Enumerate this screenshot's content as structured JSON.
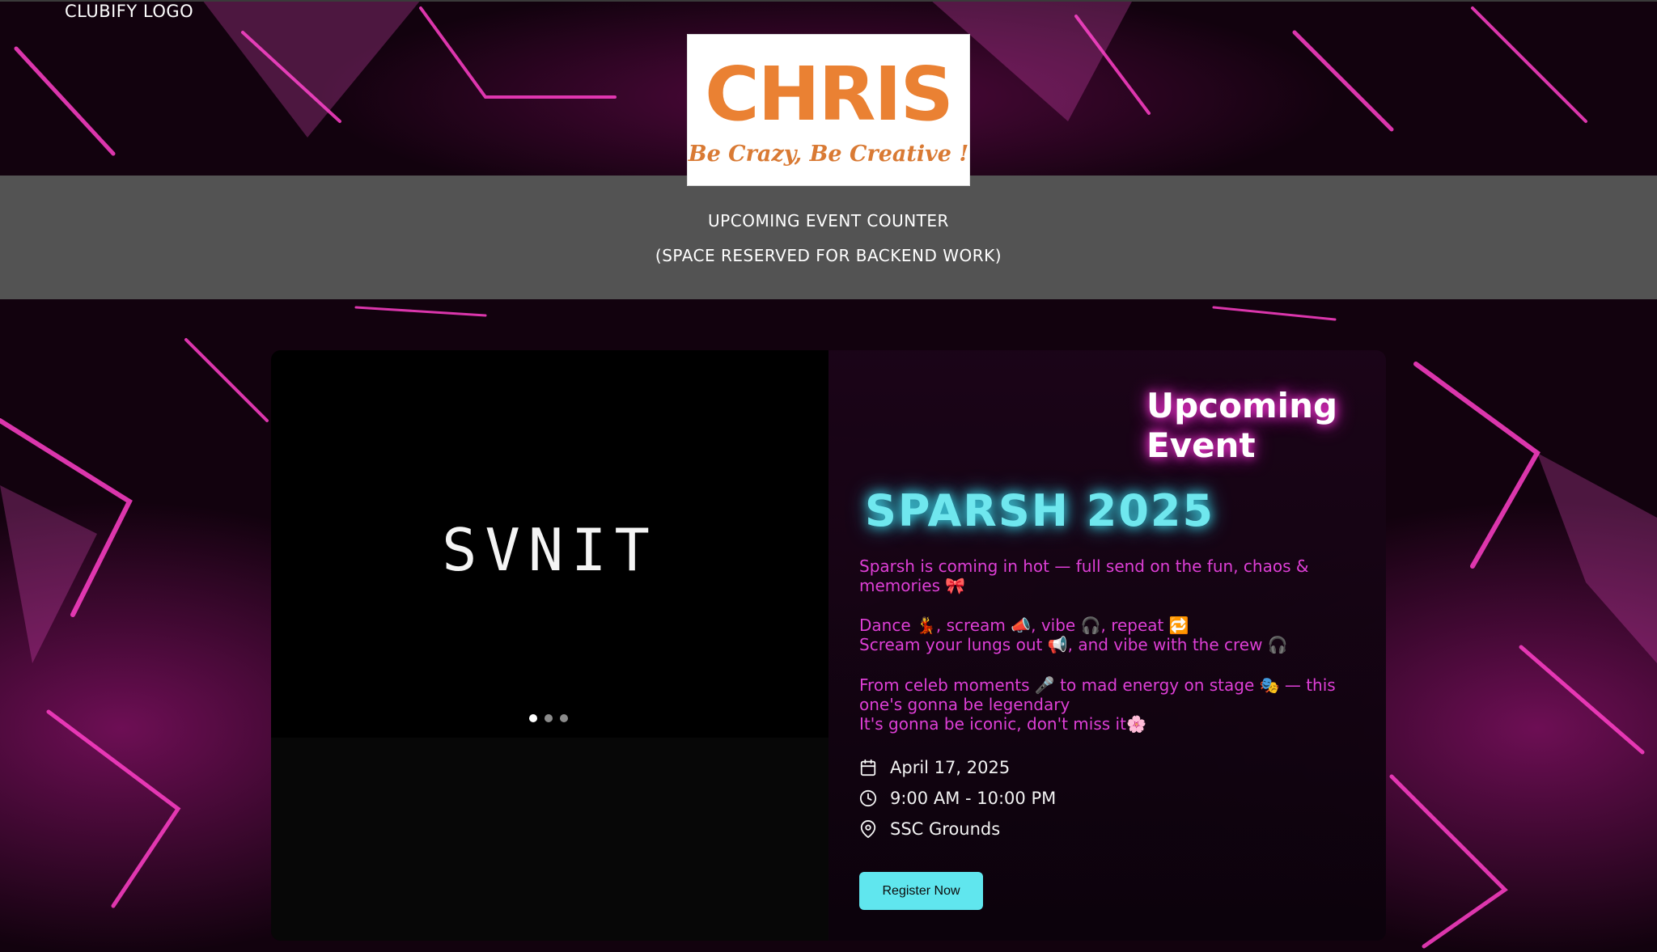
{
  "header": {
    "clubify_logo": "CLUBIFY LOGO",
    "brand_name": "CHRIS",
    "brand_tagline": "Be Crazy, Be Creative !"
  },
  "counter": {
    "title": "UPCOMING EVENT COUNTER",
    "subtitle": "(SPACE RESERVED FOR BACKEND WORK)"
  },
  "carousel": {
    "slide_text": "SVNIT",
    "dot_count": 3,
    "active_index": 0
  },
  "event": {
    "section_title": "Upcoming Event",
    "name": "SPARSH 2025",
    "desc1": "Sparsh is coming in hot — full send on the fun, chaos & memories 🎀",
    "desc2a": "Dance 💃, scream 📣, vibe 🎧, repeat 🔁",
    "desc2b": "Scream your lungs out 📢, and vibe with the crew 🎧",
    "desc3a": "From celeb moments 🎤 to mad energy on stage 🎭 — this one's gonna be legendary",
    "desc3b": "It's gonna be iconic, don't miss it🌸",
    "date": "April 17, 2025",
    "time": "9:00 AM - 10:00 PM",
    "location": "SSC Grounds",
    "register_label": "Register Now"
  },
  "icons": {
    "date": "calendar-icon",
    "time": "clock-icon",
    "location": "map-pin-icon"
  },
  "colors": {
    "accent_cyan": "#60e6ee",
    "description_pink": "#de3fd6",
    "band_gray": "#535353",
    "brand_orange": "#ea8133"
  }
}
